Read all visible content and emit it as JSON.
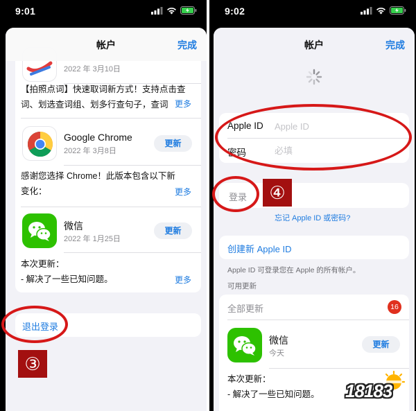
{
  "left_screen": {
    "status": {
      "time": "9:01"
    },
    "nav": {
      "title": "帐户",
      "done_label": "完成"
    },
    "apps": [
      {
        "date": "2022 年 3月10日",
        "description": "【拍照点词】快速取词新方式！支持点击查词、划选查词组、划多行查句子，查词",
        "more_label": "更多"
      },
      {
        "name": "Google Chrome",
        "date": "2022 年 3月8日",
        "update_label": "更新",
        "description": "感谢您选择 Chrome！此版本包含以下新变化：",
        "more_label": "更多"
      },
      {
        "name": "微信",
        "date": "2022 年 1月25日",
        "update_label": "更新",
        "description_line1": "本次更新：",
        "description_line2": "- 解决了一些已知问题。",
        "more_label": "更多"
      }
    ],
    "logout_label": "退出登录",
    "step_badge": "③"
  },
  "right_screen": {
    "status": {
      "time": "9:02"
    },
    "nav": {
      "title": "帐户",
      "done_label": "完成"
    },
    "form": {
      "appleid_label": "Apple ID",
      "appleid_placeholder": "Apple ID",
      "password_label": "密码",
      "password_placeholder": "必填"
    },
    "login_label": "登录",
    "step_badge": "④",
    "forgot_label": "忘记 Apple ID 或密码?",
    "create_label": "创建新 Apple ID",
    "apple_note": "Apple ID 可登录您在 Apple 的所有帐户。",
    "available_label": "可用更新",
    "update_all_label": "全部更新",
    "update_count": "16",
    "wechat": {
      "name": "微信",
      "date": "今天",
      "update_label": "更新",
      "description_line1": "本次更新：",
      "description_line2": "- 解决了一些已知问题。"
    }
  },
  "watermark": {
    "text": "18183"
  },
  "colors": {
    "accent": "#1f7ce0",
    "annotation_red": "#d61818",
    "badge_red": "#a31010",
    "wechat_green": "#2dc100"
  },
  "icons": [
    "signal-icon",
    "wifi-icon",
    "battery-icon",
    "loading-spinner-icon",
    "chrome-icon",
    "wechat-icon",
    "dictionary-app-icon"
  ]
}
